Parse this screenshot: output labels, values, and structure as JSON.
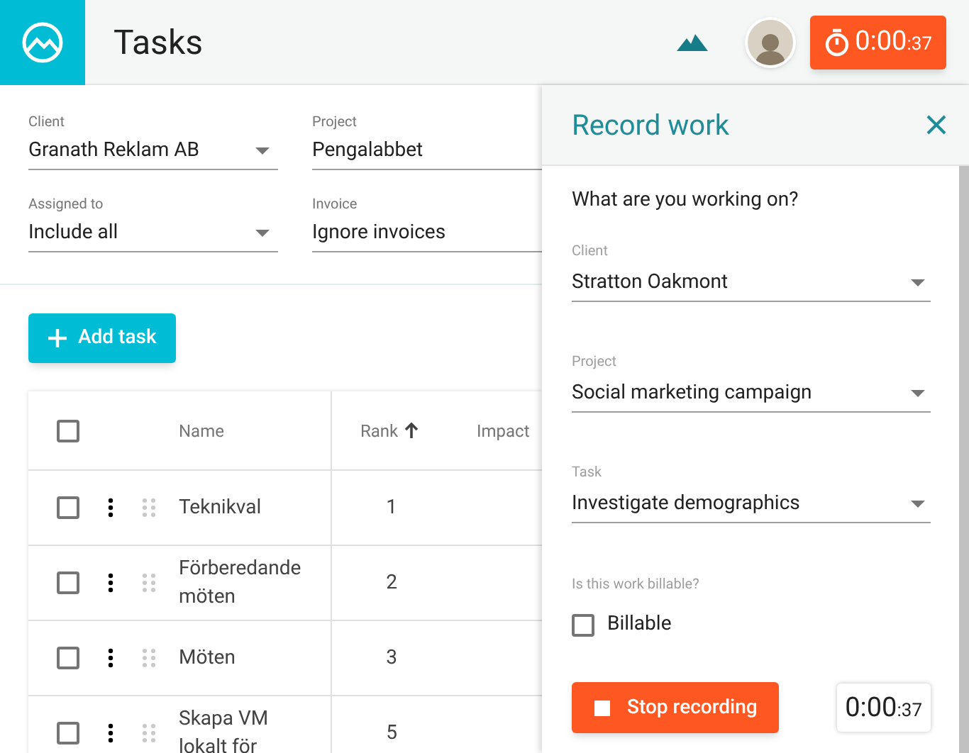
{
  "header": {
    "title": "Tasks",
    "timer": {
      "main": "0:00",
      "seconds": ":37"
    }
  },
  "filters": [
    {
      "label": "Client",
      "value": "Granath Reklam AB",
      "dropdown": true
    },
    {
      "label": "Project",
      "value": "Pengalabbet",
      "dropdown": false
    },
    {
      "label": "Assigned to",
      "value": "Include all",
      "dropdown": true
    },
    {
      "label": "Invoice",
      "value": "Ignore invoices",
      "dropdown": false
    }
  ],
  "add_button": "Add task",
  "table": {
    "all_checked": false,
    "columns": [
      {
        "label": "Name",
        "sorted": false
      },
      {
        "label": "Rank",
        "sorted": true
      },
      {
        "label": "Impact",
        "sorted": false
      }
    ],
    "rows": [
      {
        "name": "Teknikval",
        "rank": "1",
        "checked": false
      },
      {
        "name": "Förberedande möten",
        "rank": "2",
        "checked": false
      },
      {
        "name": "Möten",
        "rank": "3",
        "checked": false
      },
      {
        "name": "Skapa VM lokalt för",
        "rank": "5",
        "checked": false
      }
    ]
  },
  "drawer": {
    "title": "Record work",
    "question": "What are you working on?",
    "fields": [
      {
        "label": "Client",
        "value": "Stratton Oakmont"
      },
      {
        "label": "Project",
        "value": "Social marketing campaign"
      },
      {
        "label": "Task",
        "value": "Investigate demographics"
      }
    ],
    "billable_question": "Is this work billable?",
    "billable": {
      "label": "Billable",
      "checked": false
    },
    "stop_button": "Stop recording",
    "timer": {
      "main": "0:00",
      "seconds": ":37"
    }
  }
}
